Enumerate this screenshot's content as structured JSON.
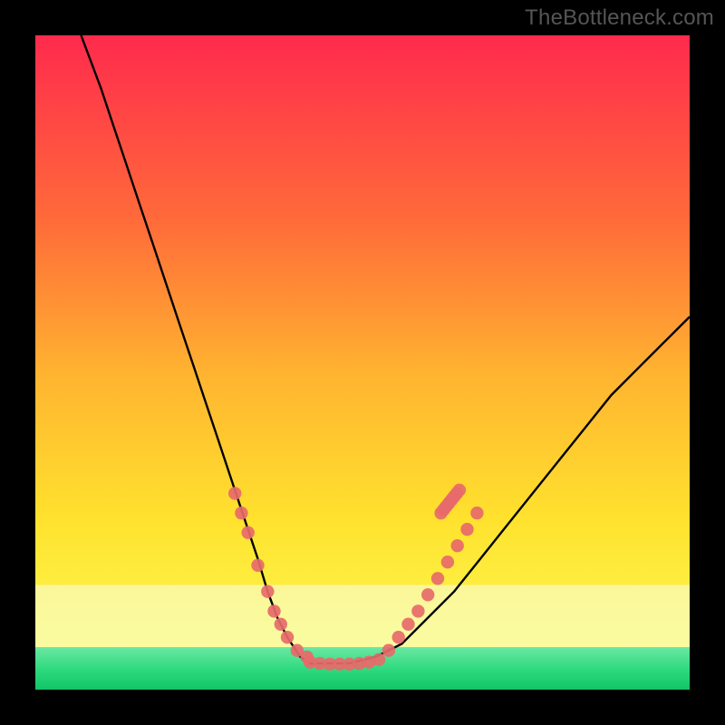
{
  "watermark": "TheBottleneck.com",
  "colors": {
    "frame": "#000000",
    "curve": "#000000",
    "marker": "#e76a6a",
    "band_pale": "#f7ffe3",
    "band_green": "#2bd97c",
    "gradient_top": "#ff2a4d",
    "gradient_mid1": "#ff6a3a",
    "gradient_mid2": "#ffb430",
    "gradient_mid3": "#ffe22e",
    "gradient_bottom": "#fbff5a"
  },
  "chart_data": {
    "type": "line",
    "title": "",
    "xlabel": "",
    "ylabel": "",
    "xlim": [
      0,
      100
    ],
    "ylim": [
      0,
      100
    ],
    "curve": {
      "name": "bottleneck-curve",
      "x": [
        7,
        10,
        12,
        14,
        16,
        18,
        20,
        22,
        24,
        26,
        28,
        30,
        32,
        34,
        35.5,
        37,
        38.5,
        40.5,
        42,
        44,
        48,
        52,
        56,
        60,
        64,
        68,
        72,
        76,
        80,
        84,
        88,
        92,
        96,
        100
      ],
      "y": [
        100,
        92,
        86,
        80,
        74,
        68,
        62,
        56,
        50,
        44,
        38,
        32,
        26,
        20,
        15,
        11,
        8,
        5,
        4,
        4,
        4,
        5,
        7,
        11,
        15,
        20,
        25,
        30,
        35,
        40,
        45,
        49,
        53,
        57
      ]
    },
    "series": [
      {
        "name": "left-arm-markers",
        "type": "scatter",
        "x": [
          30.5,
          31.5,
          32.5,
          34,
          35.5,
          36.5,
          37.5,
          38.5,
          40,
          41.5
        ],
        "y": [
          30,
          27,
          24,
          19,
          15,
          12,
          10,
          8,
          6,
          5
        ]
      },
      {
        "name": "floor-markers",
        "type": "scatter",
        "x": [
          42,
          43.5,
          45,
          46.5,
          48,
          49.5,
          51,
          52.5
        ],
        "y": [
          4.2,
          4.0,
          3.9,
          3.9,
          3.9,
          4.0,
          4.2,
          4.6
        ]
      },
      {
        "name": "right-arm-markers",
        "type": "scatter",
        "x": [
          54,
          55.5,
          57,
          58.5,
          60,
          61.5,
          63,
          64.5,
          66,
          67.5
        ],
        "y": [
          6,
          8,
          10,
          12,
          14.5,
          17,
          19.5,
          22,
          24.5,
          27
        ]
      },
      {
        "name": "right-arm-streak",
        "type": "scatter",
        "x": [
          62,
          62.4,
          62.8,
          63.2,
          63.6,
          64,
          64.4,
          64.8
        ],
        "y": [
          27,
          27.5,
          28,
          28.5,
          29,
          29.5,
          30,
          30.5
        ]
      }
    ],
    "bands": [
      {
        "name": "pale-band",
        "y0": 16,
        "y1": 6.5
      },
      {
        "name": "green-band",
        "y0": 6.5,
        "y1": 0
      }
    ]
  }
}
